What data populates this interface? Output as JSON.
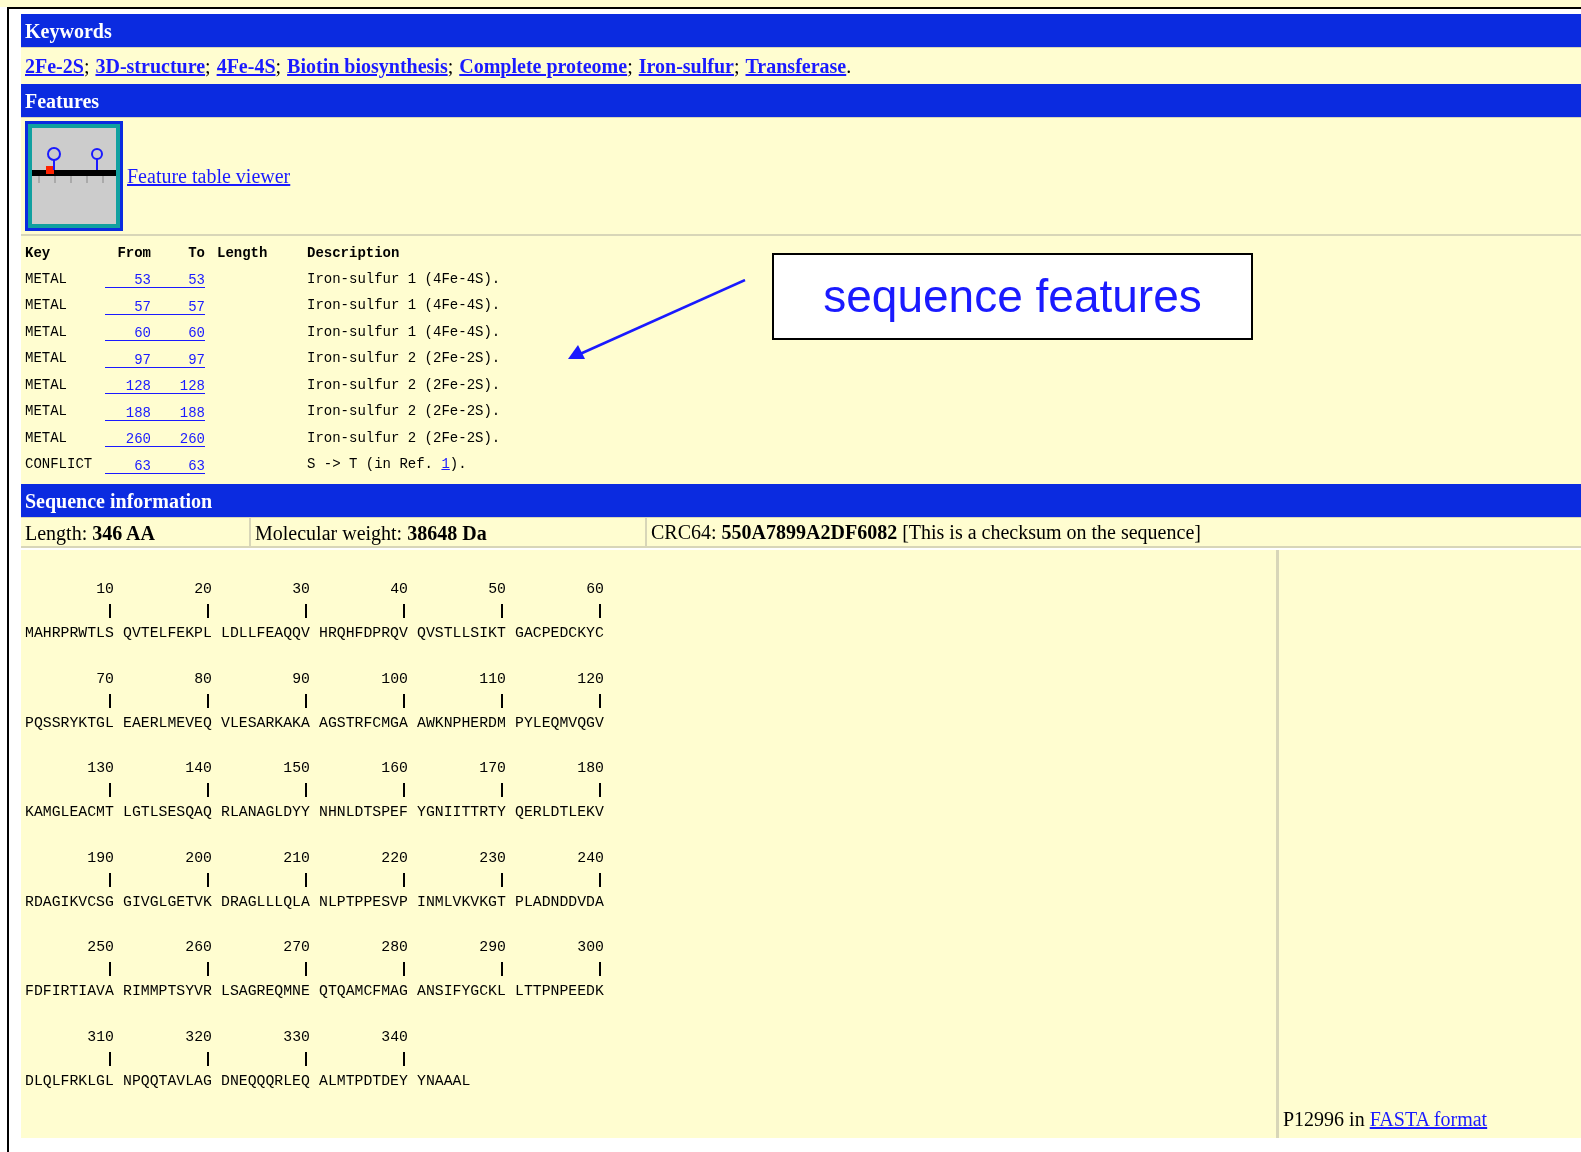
{
  "keywords": {
    "title": "Keywords",
    "items": [
      {
        "label": "2Fe-2S",
        "separator": ";"
      },
      {
        "label": "3D-structure",
        "separator": ";"
      },
      {
        "label": "4Fe-4S",
        "separator": ";"
      },
      {
        "label": "Biotin biosynthesis",
        "separator": ";"
      },
      {
        "label": "Complete proteome",
        "separator": ";"
      },
      {
        "label": "Iron-sulfur",
        "separator": ";"
      },
      {
        "label": "Transferase",
        "separator": "."
      }
    ]
  },
  "features": {
    "title": "Features",
    "viewer_link": "Feature table viewer",
    "columns": [
      "Key",
      "From",
      "To",
      "Length",
      "Description"
    ],
    "rows": [
      {
        "kind": "plain",
        "key": "METAL",
        "from": "53",
        "to": "53",
        "description": "Iron-sulfur 1 (4Fe-4S)."
      },
      {
        "kind": "plain",
        "key": "METAL",
        "from": "57",
        "to": "57",
        "description": "Iron-sulfur 1 (4Fe-4S)."
      },
      {
        "kind": "plain",
        "key": "METAL",
        "from": "60",
        "to": "60",
        "description": "Iron-sulfur 1 (4Fe-4S)."
      },
      {
        "kind": "plain",
        "key": "METAL",
        "from": "97",
        "to": "97",
        "description": "Iron-sulfur 2 (2Fe-2S)."
      },
      {
        "kind": "plain",
        "key": "METAL",
        "from": "128",
        "to": "128",
        "description": "Iron-sulfur 2 (2Fe-2S)."
      },
      {
        "kind": "plain",
        "key": "METAL",
        "from": "188",
        "to": "188",
        "description": "Iron-sulfur 2 (2Fe-2S)."
      },
      {
        "kind": "plain",
        "key": "METAL",
        "from": "260",
        "to": "260",
        "description": "Iron-sulfur 2 (2Fe-2S)."
      },
      {
        "kind": "ref",
        "key": "CONFLICT",
        "from": "63",
        "to": "63",
        "description": "S -> T (in Ref.",
        "ref": "1",
        "description_end": ")."
      }
    ]
  },
  "sequence_info": {
    "title": "Sequence information",
    "length": {
      "label": "Length:",
      "value": "346 AA"
    },
    "molecular_weight": {
      "label": "Molecular weight:",
      "value": "38648 Da"
    },
    "crc64": {
      "label": "CRC64:",
      "value": "550A7899A2DF6082",
      "note": "[This is a checksum on the sequence]"
    },
    "blocks": [
      {
        "positions": [
          "10",
          "20",
          "30",
          "40",
          "50",
          "60"
        ],
        "groups": [
          "MAHRPRWTLS",
          "QVTELFEKPL",
          "LDLLFEAQQV",
          "HRQHFDPRQV",
          "QVSTLLSIKT",
          "GACPEDCKYC"
        ]
      },
      {
        "positions": [
          "70",
          "80",
          "90",
          "100",
          "110",
          "120"
        ],
        "groups": [
          "PQSSRYKTGL",
          "EAERLMEVEQ",
          "VLESARKAKA",
          "AGSTRFCMGA",
          "AWKNPHERDM",
          "PYLEQMVQGV"
        ]
      },
      {
        "positions": [
          "130",
          "140",
          "150",
          "160",
          "170",
          "180"
        ],
        "groups": [
          "KAMGLEACMT",
          "LGTLSESQAQ",
          "RLANAGLDYY",
          "NHNLDTSPEF",
          "YGNIITTRTY",
          "QERLDTLEKV"
        ]
      },
      {
        "positions": [
          "190",
          "200",
          "210",
          "220",
          "230",
          "240"
        ],
        "groups": [
          "RDAGIKVCSG",
          "GIVGLGETVK",
          "DRAGLLLQLA",
          "NLPTPPESVP",
          "INMLVKVKGT",
          "PLADNDDVDA"
        ]
      },
      {
        "positions": [
          "250",
          "260",
          "270",
          "280",
          "290",
          "300"
        ],
        "groups": [
          "FDFIRTIAVA",
          "RIMMPTSYVR",
          "LSAGREQMNE",
          "QTQAMCFMAG",
          "ANSIFYGCKL",
          "LTTPNPEEDK"
        ]
      },
      {
        "positions": [
          "310",
          "320",
          "330",
          "340"
        ],
        "groups": [
          "DLQLFRKLGL",
          "NPQQTAVLAG",
          "DNEQQQRLEQ",
          "ALMTPDTDEY",
          "YNAAAL"
        ]
      }
    ],
    "fasta": {
      "text": "P12996 in",
      "link": "FASTA format"
    }
  },
  "annotation": {
    "text": "sequence features"
  }
}
